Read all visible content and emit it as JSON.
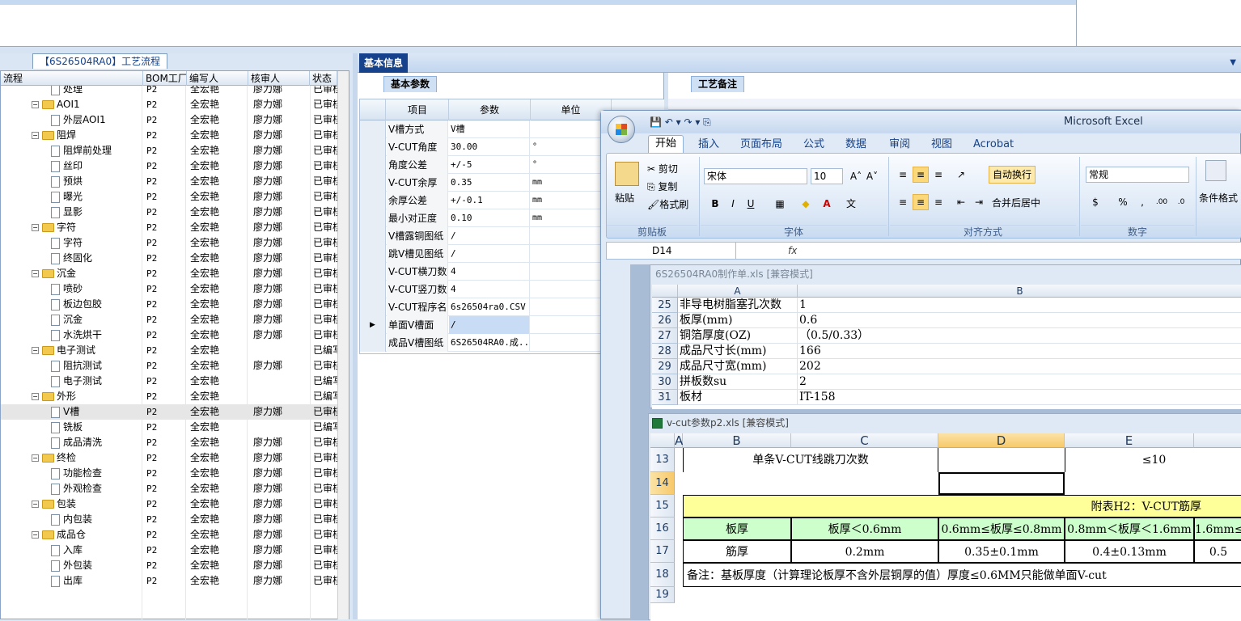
{
  "tree_panel": {
    "tab_label": "【6S26504RA0】工艺流程",
    "columns": [
      "流程",
      "BOM工厂",
      "编写人",
      "核审人",
      "状态"
    ],
    "rows": [
      {
        "level": 2,
        "type": "doc",
        "name": "处理",
        "bom": "P2",
        "writer": "全宏艳",
        "checker": "廖力娜",
        "status": "已审核"
      },
      {
        "level": 1,
        "type": "folder",
        "name": "AOI1",
        "bom": "P2",
        "writer": "全宏艳",
        "checker": "廖力娜",
        "status": "已审核"
      },
      {
        "level": 2,
        "type": "doc",
        "name": "外层AOI1",
        "bom": "P2",
        "writer": "全宏艳",
        "checker": "廖力娜",
        "status": "已审核"
      },
      {
        "level": 1,
        "type": "folder",
        "name": "阻焊",
        "bom": "P2",
        "writer": "全宏艳",
        "checker": "廖力娜",
        "status": "已审核"
      },
      {
        "level": 2,
        "type": "doc",
        "name": "阻焊前处理",
        "bom": "P2",
        "writer": "全宏艳",
        "checker": "廖力娜",
        "status": "已审核"
      },
      {
        "level": 2,
        "type": "doc",
        "name": "丝印",
        "bom": "P2",
        "writer": "全宏艳",
        "checker": "廖力娜",
        "status": "已审核"
      },
      {
        "level": 2,
        "type": "doc",
        "name": "预烘",
        "bom": "P2",
        "writer": "全宏艳",
        "checker": "廖力娜",
        "status": "已审核"
      },
      {
        "level": 2,
        "type": "doc",
        "name": "曝光",
        "bom": "P2",
        "writer": "全宏艳",
        "checker": "廖力娜",
        "status": "已审核"
      },
      {
        "level": 2,
        "type": "doc",
        "name": "显影",
        "bom": "P2",
        "writer": "全宏艳",
        "checker": "廖力娜",
        "status": "已审核"
      },
      {
        "level": 1,
        "type": "folder",
        "name": "字符",
        "bom": "P2",
        "writer": "全宏艳",
        "checker": "廖力娜",
        "status": "已审核"
      },
      {
        "level": 2,
        "type": "doc",
        "name": "字符",
        "bom": "P2",
        "writer": "全宏艳",
        "checker": "廖力娜",
        "status": "已审核"
      },
      {
        "level": 2,
        "type": "doc",
        "name": "终固化",
        "bom": "P2",
        "writer": "全宏艳",
        "checker": "廖力娜",
        "status": "已审核"
      },
      {
        "level": 1,
        "type": "folder",
        "name": "沉金",
        "bom": "P2",
        "writer": "全宏艳",
        "checker": "廖力娜",
        "status": "已审核"
      },
      {
        "level": 2,
        "type": "doc",
        "name": "喷砂",
        "bom": "P2",
        "writer": "全宏艳",
        "checker": "廖力娜",
        "status": "已审核"
      },
      {
        "level": 2,
        "type": "doc",
        "name": "板边包胶",
        "bom": "P2",
        "writer": "全宏艳",
        "checker": "廖力娜",
        "status": "已审核"
      },
      {
        "level": 2,
        "type": "doc",
        "name": "沉金",
        "bom": "P2",
        "writer": "全宏艳",
        "checker": "廖力娜",
        "status": "已审核"
      },
      {
        "level": 2,
        "type": "doc",
        "name": "水洗烘干",
        "bom": "P2",
        "writer": "全宏艳",
        "checker": "廖力娜",
        "status": "已审核"
      },
      {
        "level": 1,
        "type": "folder",
        "name": "电子测试",
        "bom": "P2",
        "writer": "全宏艳",
        "checker": "",
        "status": "已编写"
      },
      {
        "level": 2,
        "type": "doc",
        "name": "阻抗测试",
        "bom": "P2",
        "writer": "全宏艳",
        "checker": "廖力娜",
        "status": "已审核"
      },
      {
        "level": 2,
        "type": "doc",
        "name": "电子测试",
        "bom": "P2",
        "writer": "全宏艳",
        "checker": "",
        "status": "已编写"
      },
      {
        "level": 1,
        "type": "folder",
        "name": "外形",
        "bom": "P2",
        "writer": "全宏艳",
        "checker": "",
        "status": "已编写"
      },
      {
        "level": 2,
        "type": "doc",
        "name": "V槽",
        "bom": "P2",
        "writer": "全宏艳",
        "checker": "廖力娜",
        "status": "已审核",
        "selected": true
      },
      {
        "level": 2,
        "type": "doc",
        "name": "铣板",
        "bom": "P2",
        "writer": "全宏艳",
        "checker": "",
        "status": "已编写"
      },
      {
        "level": 2,
        "type": "doc",
        "name": "成品清洗",
        "bom": "P2",
        "writer": "全宏艳",
        "checker": "廖力娜",
        "status": "已审核"
      },
      {
        "level": 1,
        "type": "folder",
        "name": "终检",
        "bom": "P2",
        "writer": "全宏艳",
        "checker": "廖力娜",
        "status": "已审核"
      },
      {
        "level": 2,
        "type": "doc",
        "name": "功能检查",
        "bom": "P2",
        "writer": "全宏艳",
        "checker": "廖力娜",
        "status": "已审核"
      },
      {
        "level": 2,
        "type": "doc",
        "name": "外观检查",
        "bom": "P2",
        "writer": "全宏艳",
        "checker": "廖力娜",
        "status": "已审核"
      },
      {
        "level": 1,
        "type": "folder",
        "name": "包装",
        "bom": "P2",
        "writer": "全宏艳",
        "checker": "廖力娜",
        "status": "已审核"
      },
      {
        "level": 2,
        "type": "doc",
        "name": "内包装",
        "bom": "P2",
        "writer": "全宏艳",
        "checker": "廖力娜",
        "status": "已审核"
      },
      {
        "level": 1,
        "type": "folder",
        "name": "成品仓",
        "bom": "P2",
        "writer": "全宏艳",
        "checker": "廖力娜",
        "status": "已审核"
      },
      {
        "level": 2,
        "type": "doc",
        "name": "入库",
        "bom": "P2",
        "writer": "全宏艳",
        "checker": "廖力娜",
        "status": "已审核"
      },
      {
        "level": 2,
        "type": "doc",
        "name": "外包装",
        "bom": "P2",
        "writer": "全宏艳",
        "checker": "廖力娜",
        "status": "已审核"
      },
      {
        "level": 2,
        "type": "doc",
        "name": "出库",
        "bom": "P2",
        "writer": "全宏艳",
        "checker": "廖力娜",
        "status": "已审核"
      }
    ]
  },
  "right_panel": {
    "main_tab": "基本信息",
    "params_tab": "基本参数",
    "notes_tab": "工艺备注",
    "params_columns": [
      "项目",
      "参数",
      "单位"
    ],
    "params": [
      {
        "item": "V槽方式",
        "value": "V槽",
        "unit": ""
      },
      {
        "item": "V-CUT角度",
        "value": "30.00",
        "unit": "°"
      },
      {
        "item": "角度公差",
        "value": "+/-5",
        "unit": "°"
      },
      {
        "item": "V-CUT余厚",
        "value": "0.35",
        "unit": "mm"
      },
      {
        "item": "余厚公差",
        "value": "+/-0.1",
        "unit": "mm"
      },
      {
        "item": "最小对正度",
        "value": "0.10",
        "unit": "mm"
      },
      {
        "item": "V槽露铜图纸",
        "value": "/",
        "unit": ""
      },
      {
        "item": "跳V槽见图纸",
        "value": "/",
        "unit": ""
      },
      {
        "item": "V-CUT横刀数",
        "value": "4",
        "unit": ""
      },
      {
        "item": "V-CUT竖刀数",
        "value": "4",
        "unit": ""
      },
      {
        "item": "V-CUT程序名",
        "value": "6s26504ra0.CSV",
        "unit": ""
      },
      {
        "item": "单面V槽面",
        "value": "/",
        "unit": "",
        "selected": true
      },
      {
        "item": "成品V槽图纸",
        "value": "6S26504RA0.成...",
        "unit": ""
      }
    ]
  },
  "excel": {
    "app_title": "Microsoft Excel",
    "ribbon_tabs": [
      "开始",
      "插入",
      "页面布局",
      "公式",
      "数据",
      "审阅",
      "视图",
      "Acrobat"
    ],
    "clipboard": {
      "paste": "粘贴",
      "cut": "剪切",
      "copy": "复制",
      "format_painter": "格式刷",
      "group": "剪贴板"
    },
    "font": {
      "name": "宋体",
      "size": "10",
      "group": "字体"
    },
    "align": {
      "wrap": "自动换行",
      "merge": "合并后居中",
      "group": "对齐方式"
    },
    "number": {
      "format": "常规",
      "group": "数字"
    },
    "styles": {
      "cond_format": "条件格式"
    },
    "name_box": "D14",
    "fx": "fx",
    "wb1": {
      "title": "6S26504RA0制作单.xls  [兼容模式]",
      "col_a": "A",
      "col_b": "B",
      "rows": [
        {
          "n": "25",
          "a": "非导电树脂塞孔次数",
          "b": "1"
        },
        {
          "n": "26",
          "a": "板厚(mm)",
          "b": "0.6"
        },
        {
          "n": "27",
          "a": "铜箔厚度(OZ)",
          "b": "（0.5/0.33）"
        },
        {
          "n": "28",
          "a": "成品尺寸长(mm)",
          "b": "166"
        },
        {
          "n": "29",
          "a": "成品尺寸宽(mm)",
          "b": "202"
        },
        {
          "n": "30",
          "a": "拼板数su",
          "b": "2"
        },
        {
          "n": "31",
          "a": "板材",
          "b": "IT-158"
        }
      ]
    },
    "wb2": {
      "title": "v-cut参数p2.xls  [兼容模式]",
      "cols": [
        "A",
        "B",
        "C",
        "D",
        "E"
      ],
      "rows": [
        "13",
        "14",
        "15",
        "16",
        "17",
        "18",
        "19"
      ],
      "r13_label": "单条V-CUT线跳刀次数",
      "r13_value": "≤10",
      "r15_title": "附表H2：V-CUT筋厚",
      "r16": [
        "板厚",
        "板厚＜0.6mm",
        "0.6mm≤板厚≤0.8mm",
        "0.8mm＜板厚＜1.6mm",
        "1.6mm≤"
      ],
      "r17": [
        "筋厚",
        "0.2mm",
        "0.35±0.1mm",
        "0.4±0.13mm",
        "0.5"
      ],
      "r18": "备注：基板厚度（计算理论板厚不含外层铜厚的值）厚度≤0.6MM只能做单面V-cut"
    }
  }
}
